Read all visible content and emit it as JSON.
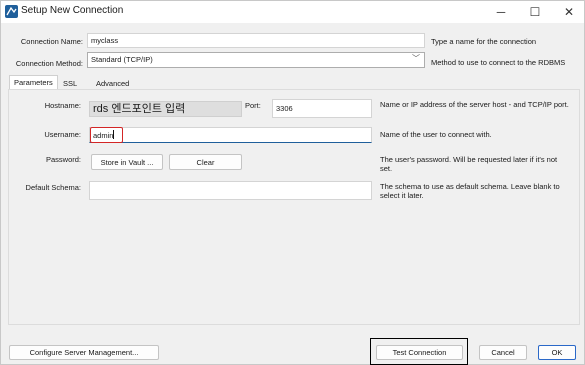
{
  "window": {
    "title": "Setup New Connection",
    "minimize_glyph": "─",
    "maximize_glyph": "☐",
    "close_glyph": "✕"
  },
  "top_form": {
    "connection_name_label": "Connection Name:",
    "connection_name_value": "myclass",
    "connection_name_hint": "Type a name for the connection",
    "connection_method_label": "Connection Method:",
    "connection_method_value": "Standard (TCP/IP)",
    "connection_method_hint": "Method to use to connect to the RDBMS"
  },
  "tabs": [
    {
      "label": "Parameters",
      "active": true
    },
    {
      "label": "SSL",
      "active": false
    },
    {
      "label": "Advanced",
      "active": false
    }
  ],
  "parameters": {
    "hostname_label": "Hostname:",
    "hostname_value": "rds 엔드포인트 입력",
    "port_label": "Port:",
    "port_value": "3306",
    "hostname_hint": "Name or IP address of the server host - and TCP/IP port.",
    "username_label": "Username:",
    "username_value": "admin",
    "username_hint": "Name of the user to connect with.",
    "password_label": "Password:",
    "store_in_vault_label": "Store in Vault ...",
    "clear_label": "Clear",
    "password_hint": "The user's password. Will be requested later if it's not set.",
    "default_schema_label": "Default Schema:",
    "default_schema_value": "",
    "default_schema_hint": "The schema to use as default schema. Leave blank to select it later."
  },
  "footer": {
    "configure_label": "Configure Server Management...",
    "test_connection_label": "Test Connection",
    "cancel_label": "Cancel",
    "ok_label": "OK"
  },
  "colors": {
    "accent": "#1f5f9b",
    "focus_outline": "#d32626",
    "primary_border": "#2a68c8"
  }
}
